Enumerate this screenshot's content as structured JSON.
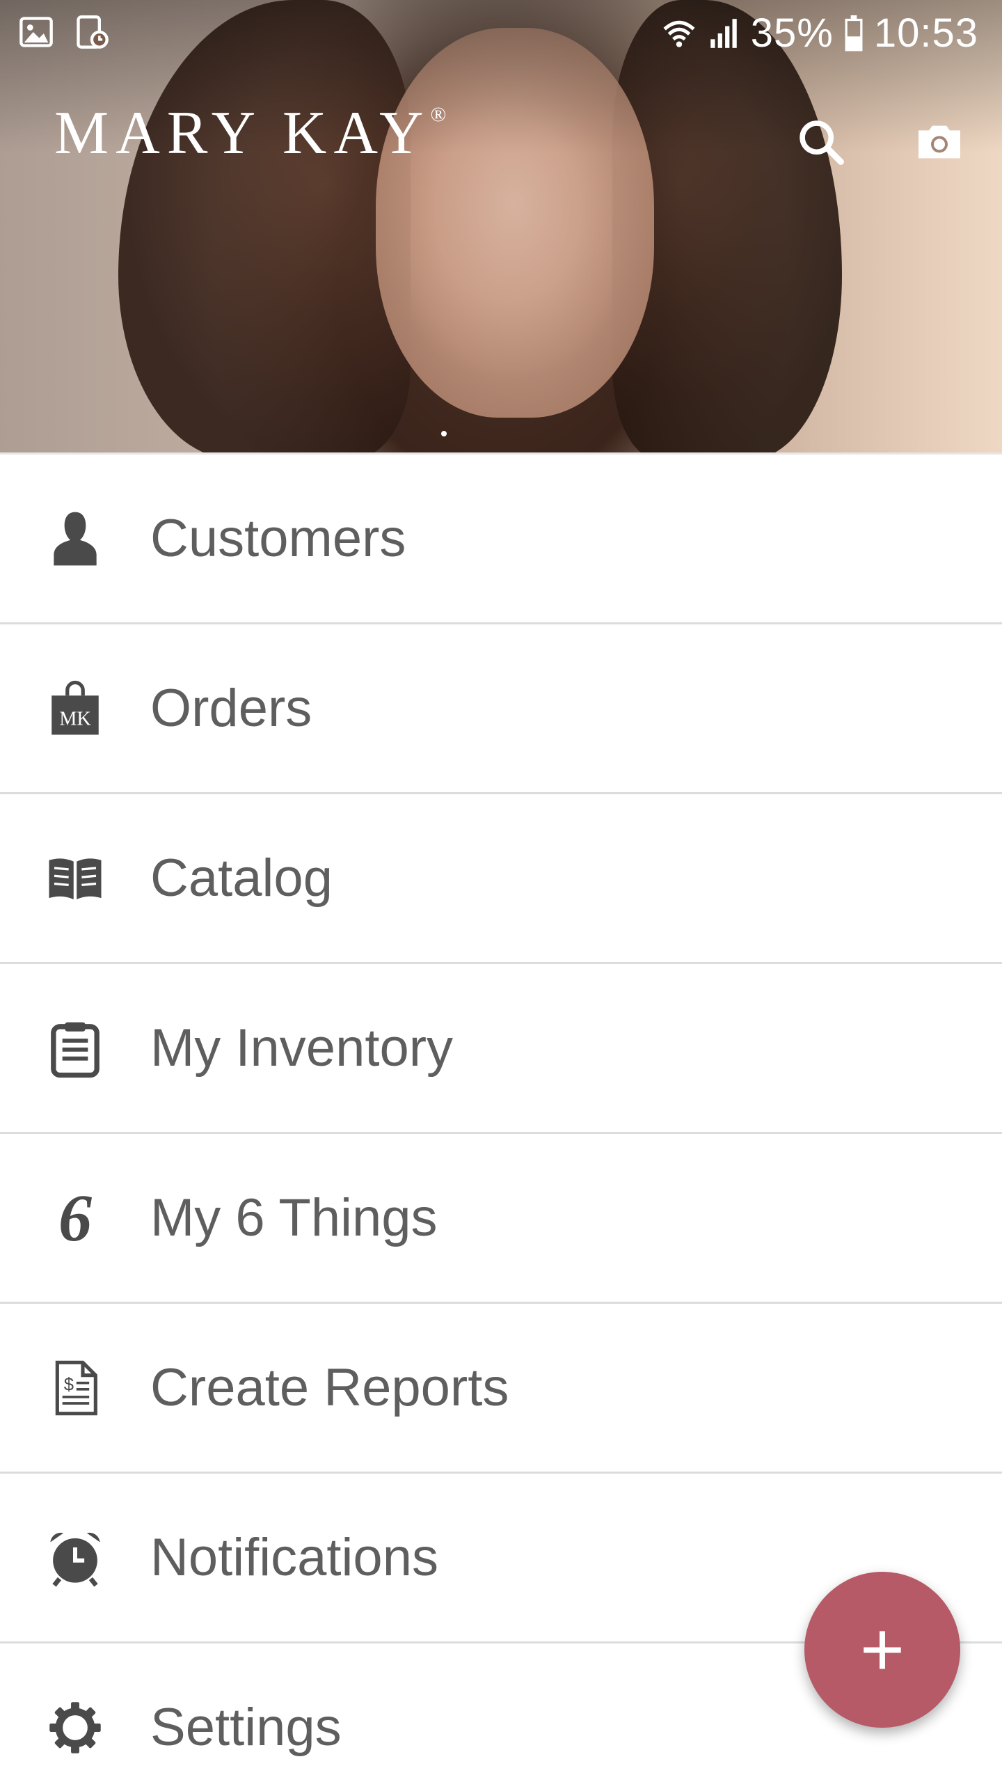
{
  "status_bar": {
    "battery_percent": "35%",
    "time": "10:53",
    "icons": [
      "gallery-icon",
      "screen-time-icon",
      "wifi-icon",
      "signal-icon",
      "battery-icon"
    ]
  },
  "header": {
    "brand": "MARY KAY",
    "brand_mark": "®",
    "actions": [
      "search-icon",
      "camera-icon"
    ]
  },
  "menu": {
    "items": [
      {
        "label": "Customers",
        "icon": "customer-silhouette-icon"
      },
      {
        "label": "Orders",
        "icon": "mk-shopping-bag-icon",
        "icon_text": "MK"
      },
      {
        "label": "Catalog",
        "icon": "open-book-icon"
      },
      {
        "label": "My Inventory",
        "icon": "clipboard-icon"
      },
      {
        "label": "My 6 Things",
        "icon": "six-icon",
        "icon_text": "6"
      },
      {
        "label": "Create Reports",
        "icon": "dollar-report-icon",
        "icon_text": "$"
      },
      {
        "label": "Notifications",
        "icon": "alarm-clock-icon"
      },
      {
        "label": "Settings",
        "icon": "gear-icon"
      }
    ]
  },
  "fab": {
    "label": "+",
    "icon": "plus-icon"
  },
  "colors": {
    "fab": "#b55a66",
    "menu_text": "#5e5e5e",
    "divider": "#dcdcdc",
    "icon": "#4a4a4a"
  }
}
